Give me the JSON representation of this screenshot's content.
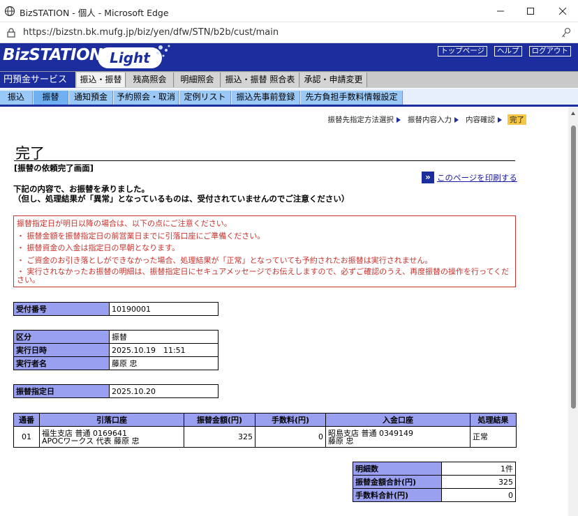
{
  "browser": {
    "window_title": "BizSTATION - 個人 - Microsoft Edge",
    "url": "https://bizstn.bk.mufg.jp/biz/yen/dfw/STN/b2b/cust/main"
  },
  "header": {
    "logo_main": "BizSTATION",
    "logo_sub": "Light",
    "links": [
      "トップページ",
      "ヘルプ",
      "ログアウト"
    ]
  },
  "main_nav": {
    "section": "円預金サービス",
    "tabs": [
      "振込・振替",
      "残高照会",
      "明細照会",
      "振込・振替 照合表",
      "承認・申請変更"
    ],
    "active_index": 0
  },
  "sub_nav": {
    "tabs": [
      "振込",
      "振替",
      "通知預金",
      "予約照会・取消",
      "定例リスト",
      "振込先事前登録",
      "先方負担手数料情報設定"
    ],
    "active_index": 1
  },
  "steps": [
    "振替先指定方法選択",
    "振替内容入力",
    "内容確認",
    "完了"
  ],
  "page": {
    "title": "完了",
    "subtitle": "[振替の依頼完了画面]",
    "print_link": "このページを印刷する",
    "intro_line1": "下記の内容で、お振替を承りました。",
    "intro_line2": "（但し、処理結果が「異常」となっているものは、受付されていませんのでご注意ください）"
  },
  "notice": {
    "lines": [
      "振替指定日が明日以降の場合は、以下の点にご注意ください。",
      "・ 振替金額を振替指定日の前営業日までに引落口座にご準備ください。",
      "・ 振替資金の入金は指定日の早朝となります。",
      "・ ご資金のお引き落としができなかった場合、処理結果が「正常」となっていても予約されたお振替は実行されません。",
      "・ 実行されなかったお振替の明細は、振替指定日にセキュアメッセージでお伝えしますので、必ずご確認のうえ、再度振替の操作を行ってください。"
    ]
  },
  "reception": {
    "label": "受付番号",
    "value": "10190001"
  },
  "info": [
    {
      "label": "区分",
      "value": "振替"
    },
    {
      "label": "実行日時",
      "value": "2025.10.19　11:51"
    },
    {
      "label": "実行者名",
      "value": "藤原 忠"
    }
  ],
  "transfer_date": {
    "label": "振替指定日",
    "value": "2025.10.20"
  },
  "detail_table": {
    "headers": [
      "通番",
      "引落口座",
      "振替金額(円)",
      "手数料(円)",
      "入金口座",
      "処理結果"
    ],
    "row": {
      "no": "01",
      "from_line1": "福生支店 普通 0169641",
      "from_line2": "APOCワークス 代表 藤原 忠",
      "amount": "325",
      "fee": "0",
      "to_line1": "昭島支店 普通 0349149",
      "to_line2": "藤原 忠",
      "result": "正常"
    }
  },
  "summary": [
    {
      "label": "明細数",
      "value": "1件"
    },
    {
      "label": "振替金額合計(円)",
      "value": "325"
    },
    {
      "label": "手数料合計(円)",
      "value": "0"
    }
  ]
}
